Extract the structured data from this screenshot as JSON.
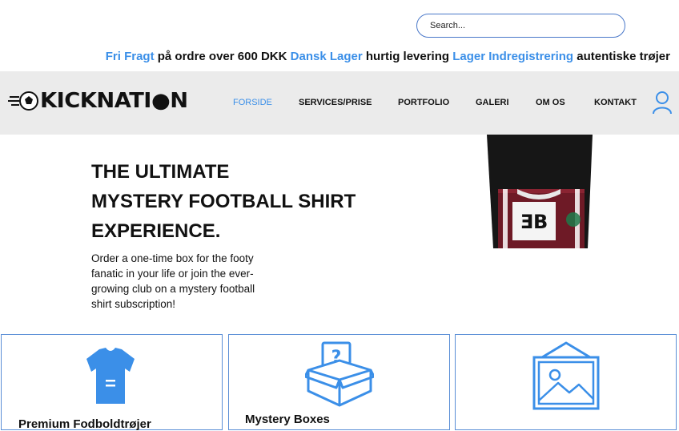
{
  "search": {
    "placeholder": "Search..."
  },
  "promo": {
    "free_shipping": "Fri Fragt",
    "free_shipping_text": "på ordre over 600 DKK",
    "danish_stock": "Dansk Lager",
    "danish_stock_text": "hurtig levering",
    "stock_registration": "Lager Indregistrering",
    "stock_registration_text": "autentiske trøjer"
  },
  "brand": {
    "logo_text": "KICKNATI●N"
  },
  "nav": {
    "items": [
      {
        "label": "FORSIDE",
        "active": true
      },
      {
        "label": "SERVICES/PRISE",
        "active": false
      },
      {
        "label": "PORTFOLIO",
        "active": false
      },
      {
        "label": "GALERI",
        "active": false
      },
      {
        "label": "OM OS",
        "active": false
      },
      {
        "label": "KONTAKT",
        "active": false
      }
    ]
  },
  "hero": {
    "title_lines": [
      "THE ULTIMATE",
      "MYSTERY FOOTBALL SHIRT",
      "EXPERIENCE."
    ],
    "description": "Order a one-time box for the footy fanatic in your life or join the ever-growing club on a mystery football shirt subscription!"
  },
  "cards": [
    {
      "title": "Premium Fodboldtrøjer",
      "icon": "jersey-icon"
    },
    {
      "title": "Mystery Boxes",
      "icon": "mystery-box-icon"
    },
    {
      "title": "",
      "icon": "image-placeholder-icon"
    }
  ],
  "colors": {
    "accent": "#3b8fe8",
    "navbar_bg": "#ebebeb",
    "card_border": "#5a8ed6"
  }
}
